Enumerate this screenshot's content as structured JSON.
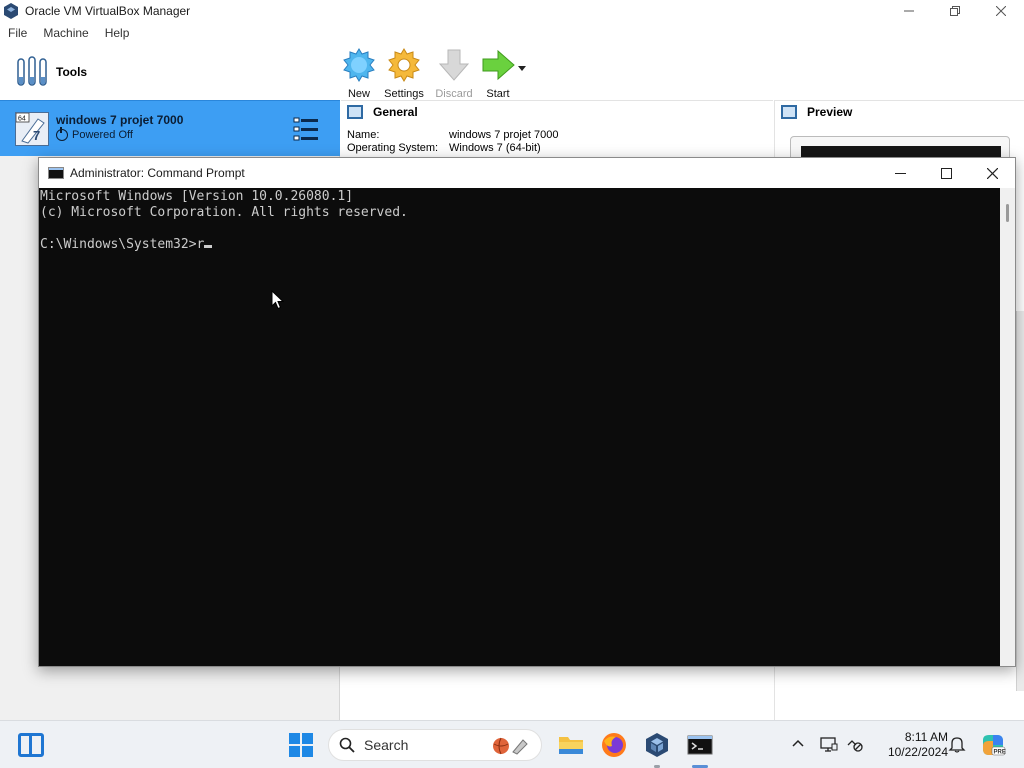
{
  "vbox": {
    "title": "Oracle VM VirtualBox Manager",
    "menu": [
      "File",
      "Machine",
      "Help"
    ],
    "tools_label": "Tools",
    "toolbar": {
      "new": "New",
      "settings": "Settings",
      "discard": "Discard",
      "start": "Start"
    },
    "vm": {
      "name": "windows 7 projet 7000",
      "state": "Powered Off",
      "os_badge": "64",
      "os_number": "7"
    },
    "details": {
      "section_title": "General",
      "name_key": "Name:",
      "name_value": "windows 7 projet 7000",
      "os_key": "Operating System:",
      "os_value": "Windows 7 (64-bit)"
    },
    "preview_title": "Preview"
  },
  "cmd": {
    "title": "Administrator: Command Prompt",
    "line1": "Microsoft Windows [Version 10.0.26080.1]",
    "line2": "(c) Microsoft Corporation. All rights reserved.",
    "prompt": "C:\\Windows\\System32>",
    "typed": "r"
  },
  "taskbar": {
    "search_label": "Search",
    "time": "8:11 AM",
    "date": "10/22/2024"
  },
  "colors": {
    "vm_selected": "#3d9ef3",
    "console_bg": "#0c0c0c",
    "console_fg": "#cccccc",
    "accent": "#1f76d2"
  },
  "icons": [
    "virtualbox-icon",
    "tools-icon",
    "new-vm-icon",
    "settings-gear-icon",
    "discard-arrow-icon",
    "start-arrow-icon",
    "hamburger-menu-icon",
    "power-icon",
    "general-section-icon",
    "preview-section-icon",
    "cmd-icon",
    "widgets-icon",
    "windows-start-icon",
    "search-icon",
    "file-explorer-icon",
    "firefox-icon",
    "virtualbox-taskbar-icon",
    "terminal-taskbar-icon",
    "chevron-up-icon",
    "network-icon",
    "battery-icon",
    "bell-icon",
    "copilot-icon"
  ]
}
